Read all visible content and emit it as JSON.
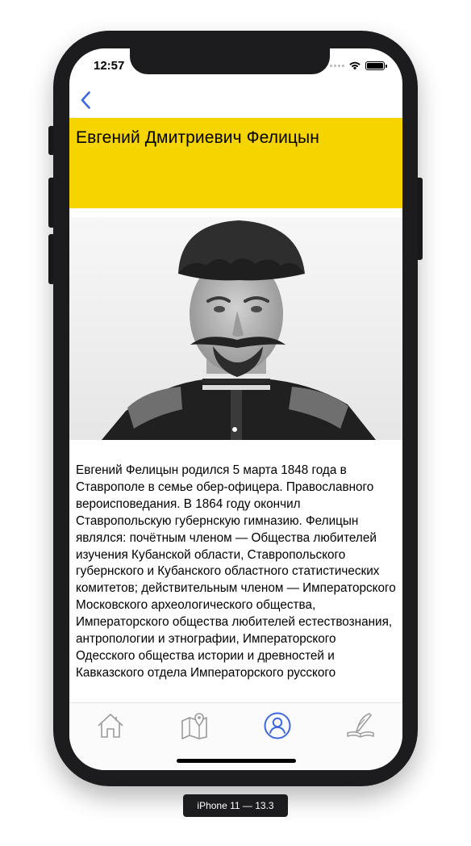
{
  "status": {
    "time": "12:57"
  },
  "header": {
    "title": "Евгений Дмитриевич Фелицын"
  },
  "bio": {
    "text": "Евгений Фелицын родился 5 марта 1848 года в Ставрополе в семье обер-офицера. Православного вероисповедания. В 1864 году окончил Ставропольскую губернскую гимназию. Фелицын являлся: почётным членом — Общества любителей изучения Кубанской области, Ставропольского губернского и Кубанского областного статистических комитетов; действительным членом — Императорского Московского археологического общества, Императорского общества любителей естествознания, антропологии и этнографии, Императорского Одесского общества истории и древностей и Кавказского отдела Императорского русского"
  },
  "tabbar": {
    "active": "profile",
    "active_color": "#3f67e0",
    "inactive_color": "#9a9a9a",
    "items": [
      {
        "id": "home",
        "icon": "home-icon"
      },
      {
        "id": "map",
        "icon": "map-pin-icon"
      },
      {
        "id": "profile",
        "icon": "person-icon"
      },
      {
        "id": "writing",
        "icon": "quill-book-icon"
      }
    ]
  },
  "colors": {
    "title_bar": "#f5d400",
    "back_button": "#3f67e0"
  },
  "device": {
    "label": "iPhone 11 — 13.3"
  }
}
